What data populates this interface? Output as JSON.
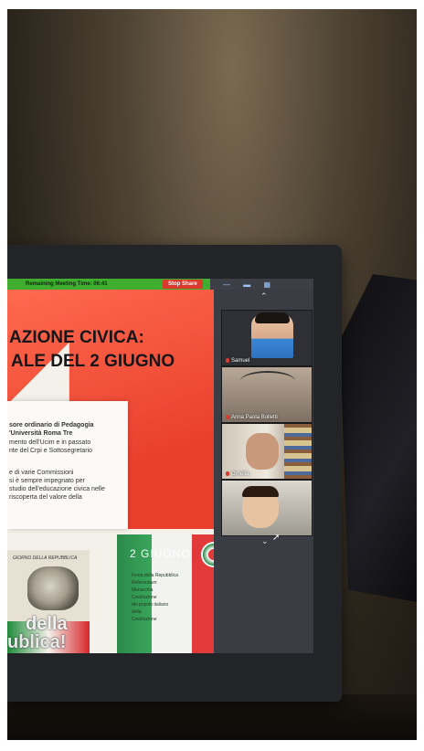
{
  "meeting": {
    "timer_label": "Remaining Meeting Time: 06:41",
    "stop_share_label": "Stop Share",
    "view_controls": "— ▬ ▦"
  },
  "slide": {
    "title_line1": "AZIONE CIVICA:",
    "title_line2": "ALE DEL 2 GIUGNO",
    "bio_lines": [
      "sore ordinario di Pedagogia",
      "'Università Roma Tre",
      "mento dell'Ucim e in passato",
      "nte del Crpi e Sottosegretario",
      "",
      "e di varie Commissioni",
      "si è sempre impegnato per",
      "studio dell'educazione civica nelle",
      "riscoperta del valore della"
    ],
    "poster": {
      "top_text": "GIORNO DELLA REPUBBLICA",
      "word1": "della",
      "word2": "ublica!"
    },
    "tricolor": {
      "title": "2 GIUGNO",
      "lines": [
        "Festa della Repubblica",
        "Referendum",
        "Monarchia",
        "Costituzione",
        "del popolo italiano",
        "della",
        "Costituzione"
      ]
    }
  },
  "participants": [
    {
      "name": "Samuel"
    },
    {
      "name": "Anna Paola Bolletti"
    },
    {
      "name": "Ornella"
    },
    {
      "name": ""
    }
  ],
  "colors": {
    "timer_green": "#3fae2e",
    "stop_red": "#d93a2b",
    "slide_red": "#e9402c"
  }
}
